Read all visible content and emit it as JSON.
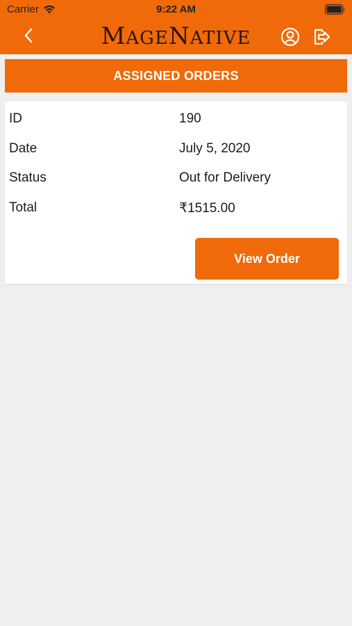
{
  "status_bar": {
    "carrier": "Carrier",
    "time": "9:22 AM"
  },
  "nav": {
    "logo_parts": {
      "first_big": "M",
      "first_small": "AGE",
      "second_big": "N",
      "second_small": "ATIVE"
    },
    "icons": {
      "back": "chevron-left-icon",
      "profile": "user-circle-icon",
      "logout": "logout-icon"
    }
  },
  "section": {
    "title": "ASSIGNED ORDERS"
  },
  "order": {
    "rows": [
      {
        "label": "ID",
        "value": "190"
      },
      {
        "label": "Date",
        "value": "July 5, 2020"
      },
      {
        "label": "Status",
        "value": "Out for Delivery"
      },
      {
        "label": "Total",
        "value": "₹1515.00"
      }
    ],
    "view_button": "View Order"
  },
  "colors": {
    "accent": "#f06a0a",
    "background": "#efefef",
    "card": "#ffffff",
    "logo": "#2a1608"
  }
}
